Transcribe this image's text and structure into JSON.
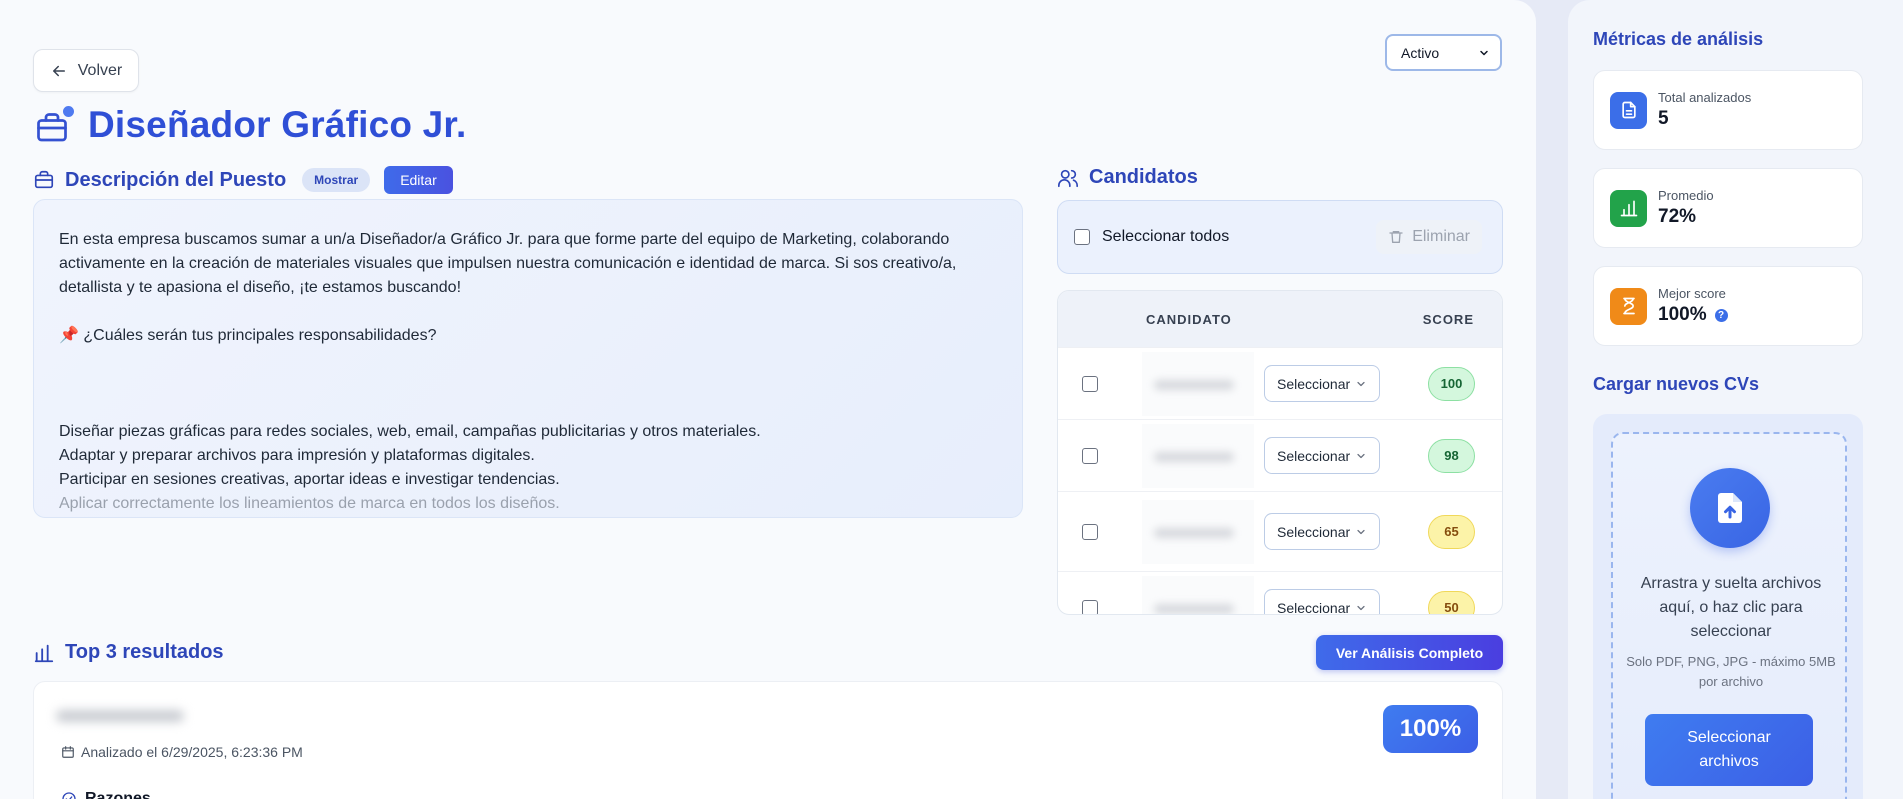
{
  "header": {
    "back_label": "Volver",
    "status_selected": "Activo",
    "job_title": "Diseñador Gráfico Jr."
  },
  "description": {
    "section_title": "Descripción del Puesto",
    "toggle_label": "Mostrar",
    "edit_label": "Editar",
    "paragraph_intro": "En esta empresa buscamos sumar a un/a Diseñador/a Gráfico Jr. para que forme parte del equipo de Marketing, colaborando activamente en la creación de materiales visuales que impulsen nuestra comunicación e identidad de marca. Si sos creativo/a, detallista y te apasiona el diseño, ¡te estamos buscando!",
    "pin_emoji": "📌",
    "responsibilities_heading": "¿Cuáles serán tus principales responsabilidades?",
    "lines": [
      "Diseñar piezas gráficas para redes sociales, web, email, campañas publicitarias y otros materiales.",
      "Adaptar y preparar archivos para impresión y plataformas digitales.",
      "Participar en sesiones creativas, aportar ideas e investigar tendencias.",
      "Aplicar correctamente los lineamientos de marca en todos los diseños."
    ]
  },
  "candidates": {
    "section_title": "Candidatos",
    "select_all_label": "Seleccionar todos",
    "delete_label": "Eliminar",
    "col_candidate": "CANDIDATO",
    "col_score": "SCORE",
    "rows": [
      {
        "select_label": "Seleccionar",
        "score": "100",
        "tier": "green"
      },
      {
        "select_label": "Seleccionar",
        "score": "98",
        "tier": "green"
      },
      {
        "select_label": "Seleccionar",
        "score": "65",
        "tier": "yellow"
      },
      {
        "select_label": "Seleccionar",
        "score": "50",
        "tier": "yellow"
      }
    ]
  },
  "top3": {
    "section_title": "Top 3 resultados",
    "view_full_label": "Ver Análisis Completo",
    "first": {
      "analyzed_text": "Analizado el 6/29/2025, 6:23:36 PM",
      "score_badge": "100%",
      "reasons_label": "Razones"
    }
  },
  "metrics": {
    "section_title": "Métricas de análisis",
    "items": [
      {
        "label": "Total analizados",
        "value": "5",
        "icon": "document-icon",
        "color": "#3b6ee8"
      },
      {
        "label": "Promedio",
        "value": "72%",
        "icon": "bar-chart-icon",
        "color": "#22a34a"
      },
      {
        "label": "Mejor score",
        "value": "100%",
        "icon": "hourglass-icon",
        "color": "#f08a18",
        "help": "?"
      }
    ]
  },
  "upload": {
    "section_title": "Cargar nuevos CVs",
    "drop_text": "Arrastra y suelta archivos aquí, o haz clic para seleccionar",
    "hint_text": "Solo PDF, PNG, JPG - máximo 5MB por archivo",
    "button_label": "Seleccionar archivos"
  }
}
